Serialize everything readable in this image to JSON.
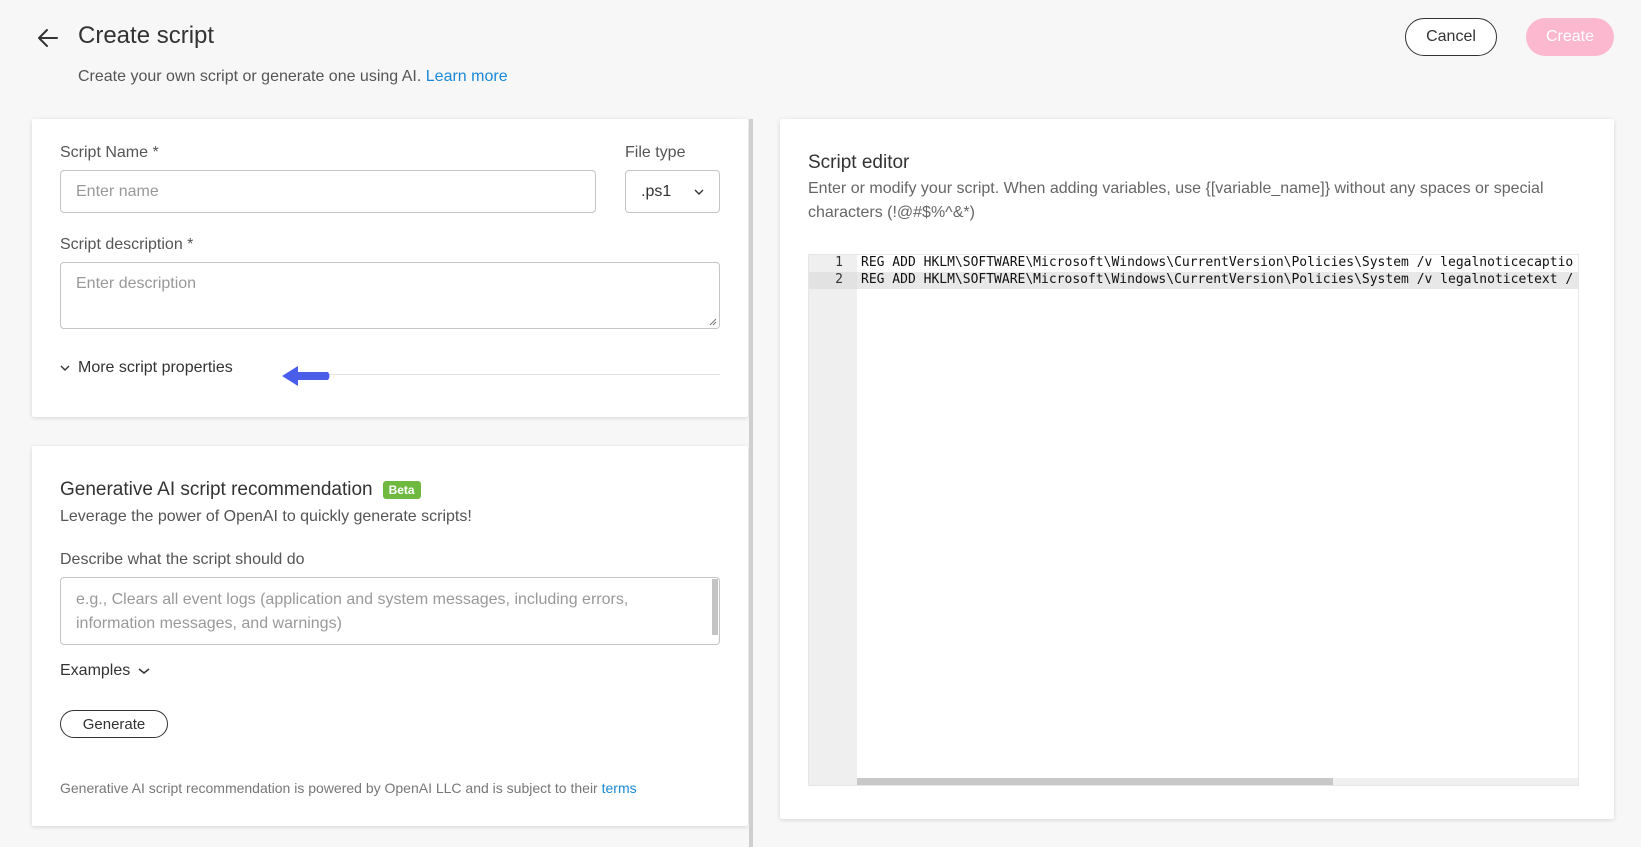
{
  "header": {
    "title": "Create script",
    "subtitle": "Create your own script or generate one using AI.",
    "learn_more": "Learn more",
    "cancel_label": "Cancel",
    "create_label": "Create"
  },
  "properties": {
    "name_label": "Script Name *",
    "name_placeholder": "Enter name",
    "file_type_label": "File type",
    "file_type_value": ".ps1",
    "description_label": "Script description *",
    "description_placeholder": "Enter description",
    "more_label": "More script properties"
  },
  "ai": {
    "title": "Generative AI script recommendation",
    "badge": "Beta",
    "subtitle": "Leverage the power of OpenAI to quickly generate scripts!",
    "prompt_label": "Describe what the script should do",
    "prompt_placeholder": "e.g., Clears all event logs (application and system messages, including errors, information messages, and warnings)",
    "examples_label": "Examples",
    "generate_label": "Generate",
    "footer_text": "Generative AI script recommendation is powered by OpenAI LLC and is subject to their",
    "footer_link": "terms"
  },
  "editor": {
    "title": "Script editor",
    "subtitle": "Enter or modify your script. When adding variables, use {[variable_name]} without any spaces or special characters (!@#$%^&*)",
    "lines": [
      {
        "num": "1",
        "code": "REG ADD HKLM\\SOFTWARE\\Microsoft\\Windows\\CurrentVersion\\Policies\\System /v legalnoticecaptio"
      },
      {
        "num": "2",
        "code": "REG ADD HKLM\\SOFTWARE\\Microsoft\\Windows\\CurrentVersion\\Policies\\System /v legalnoticetext /"
      }
    ]
  },
  "colors": {
    "accent_link": "#1a88d6",
    "create_button": "#fcb8cf",
    "beta_badge": "#6fb940",
    "pointer_arrow": "#4a5de8"
  }
}
